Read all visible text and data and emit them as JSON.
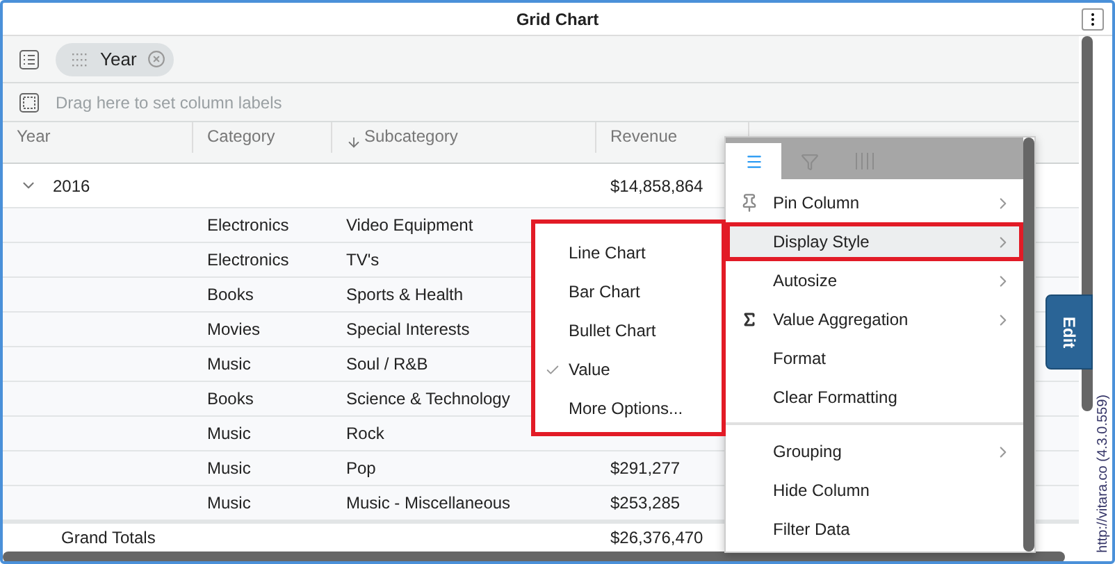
{
  "window": {
    "title": "Grid Chart"
  },
  "row_groups": [
    {
      "label": "Year"
    }
  ],
  "column_drop": {
    "placeholder": "Drag here to set column labels"
  },
  "columns": [
    {
      "label": "Year",
      "sorted": false
    },
    {
      "label": "Category",
      "sorted": false
    },
    {
      "label": "Subcategory",
      "sorted": true
    },
    {
      "label": "Revenue",
      "sorted": false
    }
  ],
  "groups": [
    {
      "year": "2016",
      "revenue": "$14,858,864",
      "expanded": true,
      "rows": [
        {
          "category": "Electronics",
          "subcategory": "Video Equipment"
        },
        {
          "category": "Electronics",
          "subcategory": "TV's"
        },
        {
          "category": "Books",
          "subcategory": "Sports & Health"
        },
        {
          "category": "Movies",
          "subcategory": "Special Interests"
        },
        {
          "category": "Music",
          "subcategory": "Soul / R&B"
        },
        {
          "category": "Books",
          "subcategory": "Science & Technology"
        },
        {
          "category": "Music",
          "subcategory": "Rock"
        },
        {
          "category": "Music",
          "subcategory": "Pop",
          "revenue": "$291,277"
        },
        {
          "category": "Music",
          "subcategory": "Music - Miscellaneous",
          "revenue": "$253,285"
        }
      ]
    }
  ],
  "grand_total": {
    "label": "Grand Totals",
    "revenue": "$26,376,470"
  },
  "column_menu": {
    "tabs": [
      {
        "kind": "menu",
        "selected": true
      },
      {
        "kind": "filter",
        "selected": false
      },
      {
        "kind": "columns",
        "selected": false
      }
    ],
    "items": [
      {
        "label": "Pin Column",
        "kind": "pin",
        "submenu": true,
        "selected": false
      },
      {
        "label": "Display Style",
        "kind": "plain",
        "submenu": true,
        "selected": true
      },
      {
        "label": "Autosize",
        "kind": "plain",
        "submenu": true,
        "selected": false
      },
      {
        "label": "Value Aggregation",
        "kind": "sigma",
        "submenu": true,
        "selected": false
      },
      {
        "label": "Format",
        "kind": "plain",
        "submenu": false,
        "selected": false
      },
      {
        "label": "Clear Formatting",
        "kind": "plain",
        "submenu": false,
        "selected": false,
        "separator_after": true
      },
      {
        "label": "Grouping",
        "kind": "plain",
        "submenu": true,
        "selected": false
      },
      {
        "label": "Hide Column",
        "kind": "plain",
        "submenu": false,
        "selected": false
      },
      {
        "label": "Filter Data",
        "kind": "plain",
        "submenu": false,
        "selected": false
      }
    ]
  },
  "display_style_menu": {
    "items": [
      {
        "label": "Line Chart",
        "checked": false
      },
      {
        "label": "Bar Chart",
        "checked": false
      },
      {
        "label": "Bullet Chart",
        "checked": false
      },
      {
        "label": "Value",
        "checked": true
      },
      {
        "label": "More Options...",
        "checked": false
      }
    ]
  },
  "edit_button": {
    "label": "Edit"
  },
  "version_label": "http://vitara.co (4.3.0.559)"
}
